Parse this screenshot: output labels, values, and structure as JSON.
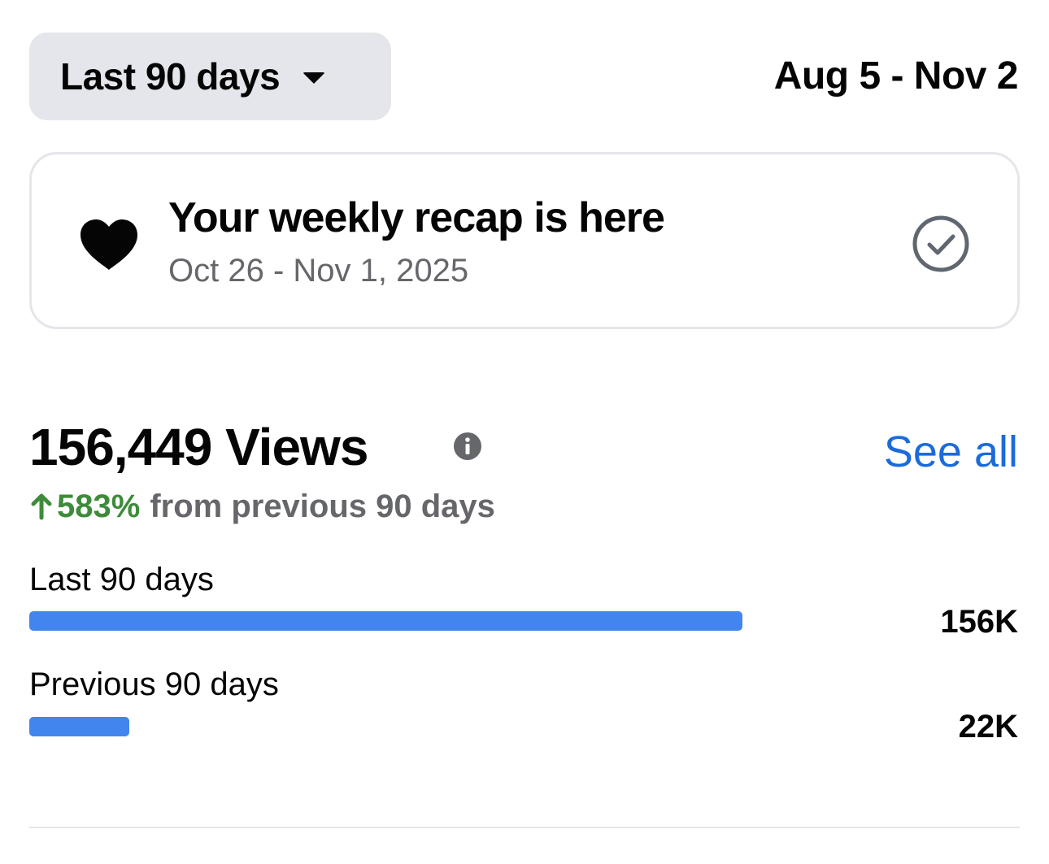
{
  "header": {
    "range_selector": "Last 90 days",
    "date_range": "Aug 5 - Nov 2"
  },
  "recap": {
    "title": "Your weekly recap is here",
    "dates": "Oct 26 - Nov 1, 2025"
  },
  "views": {
    "title": "156,449 Views",
    "see_all": "See all",
    "change_pct": "583%",
    "change_text": "from previous 90 days",
    "change_color": "#3e8b3a",
    "comparison": [
      {
        "label": "Last 90 days",
        "value_label": "156K",
        "value": 156449
      },
      {
        "label": "Previous 90 days",
        "value_label": "22K",
        "value": 22000
      }
    ],
    "bar_color": "#4285ef",
    "link_color": "#1b6bd9"
  }
}
